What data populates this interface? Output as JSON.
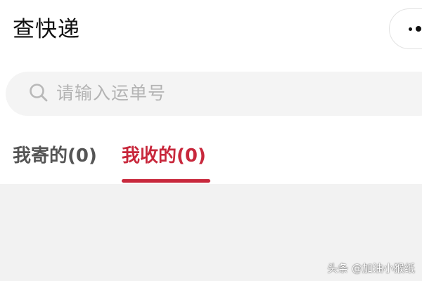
{
  "header": {
    "title": "查快递",
    "menu_icon": "more-dots-icon"
  },
  "search": {
    "placeholder": "请输入运单号",
    "icon": "search-icon"
  },
  "tabs": [
    {
      "label": "我寄的(0)",
      "active": false
    },
    {
      "label": "我收的(0)",
      "active": true
    }
  ],
  "colors": {
    "accent": "#c8283c",
    "inactive_tab": "#555555",
    "placeholder": "#b3b3b3",
    "search_bg": "#f4f4f4",
    "content_bg": "#f2f2f2"
  },
  "watermark": "头条 @加油小猴纸"
}
